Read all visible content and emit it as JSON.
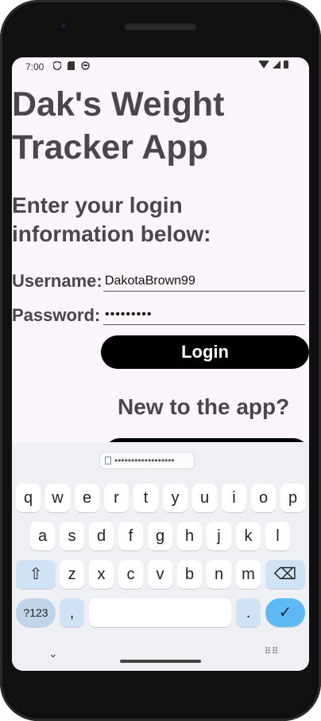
{
  "status_bar": {
    "time": "7:00",
    "left_icons": [
      "shield-icon",
      "sd-card-icon",
      "ghost-icon"
    ],
    "right_icons": [
      "wifi-icon",
      "signal-icon",
      "battery-icon"
    ]
  },
  "app": {
    "title": "Dak's Weight Tracker App",
    "subtitle": "Enter your login information below:",
    "username_label": "Username:",
    "username_value": "DakotaBrown99",
    "password_label": "Password:",
    "password_value": "•••••••••",
    "login_label": "Login",
    "new_user_text": "New to the app?"
  },
  "keyboard": {
    "clipboard_text": "••••••••••••••••••",
    "row1": [
      "q",
      "w",
      "e",
      "r",
      "t",
      "y",
      "u",
      "i",
      "o",
      "p"
    ],
    "row2": [
      "a",
      "s",
      "d",
      "f",
      "g",
      "h",
      "j",
      "k",
      "l"
    ],
    "row3": [
      "z",
      "x",
      "c",
      "v",
      "b",
      "n",
      "m"
    ],
    "symbols_label": "?123",
    "comma": ",",
    "period": ".",
    "shift_icon": "⇧",
    "backspace_icon": "⌫",
    "enter_icon": "✓",
    "hide_icon": "⌄",
    "grid_icon": "⠿⠿"
  },
  "colors": {
    "screen_bg": "#fbf4fb",
    "text": "#4a4650",
    "button": "#000000",
    "keyboard_bg": "#eef0f4",
    "enter_key": "#5eb8f4"
  }
}
